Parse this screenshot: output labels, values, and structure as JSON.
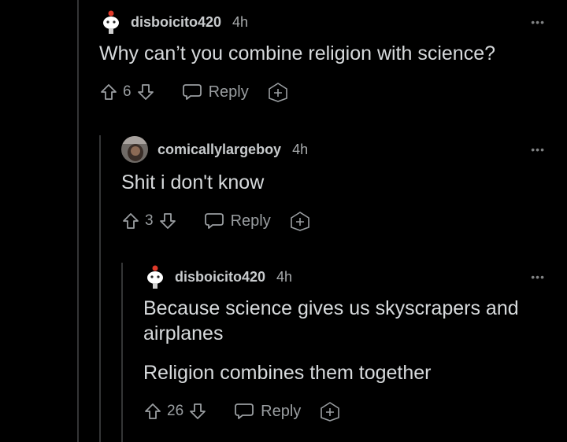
{
  "comments": [
    {
      "username": "disboicito420",
      "time": "4h",
      "body": [
        "Why can’t you combine religion with science?"
      ],
      "votes": "6",
      "reply_label": "Reply",
      "avatar": "snoo-avatar"
    },
    {
      "username": "comicallylargeboy",
      "time": "4h",
      "body": [
        "Shit i don't know"
      ],
      "votes": "3",
      "reply_label": "Reply",
      "avatar": "photo-avatar"
    },
    {
      "username": "disboicito420",
      "time": "4h",
      "body": [
        "Because science gives us skyscrapers and airplanes",
        "Religion combines them together"
      ],
      "votes": "26",
      "reply_label": "Reply",
      "avatar": "snoo-avatar"
    }
  ],
  "more_glyph": "•••",
  "icons": [
    "upvote-icon",
    "downvote-icon",
    "reply-icon",
    "award-icon",
    "more-options-icon"
  ],
  "colors": {
    "background": "#000000",
    "text": "#d7dadc",
    "muted": "#818384",
    "thread_line": "#343536"
  }
}
